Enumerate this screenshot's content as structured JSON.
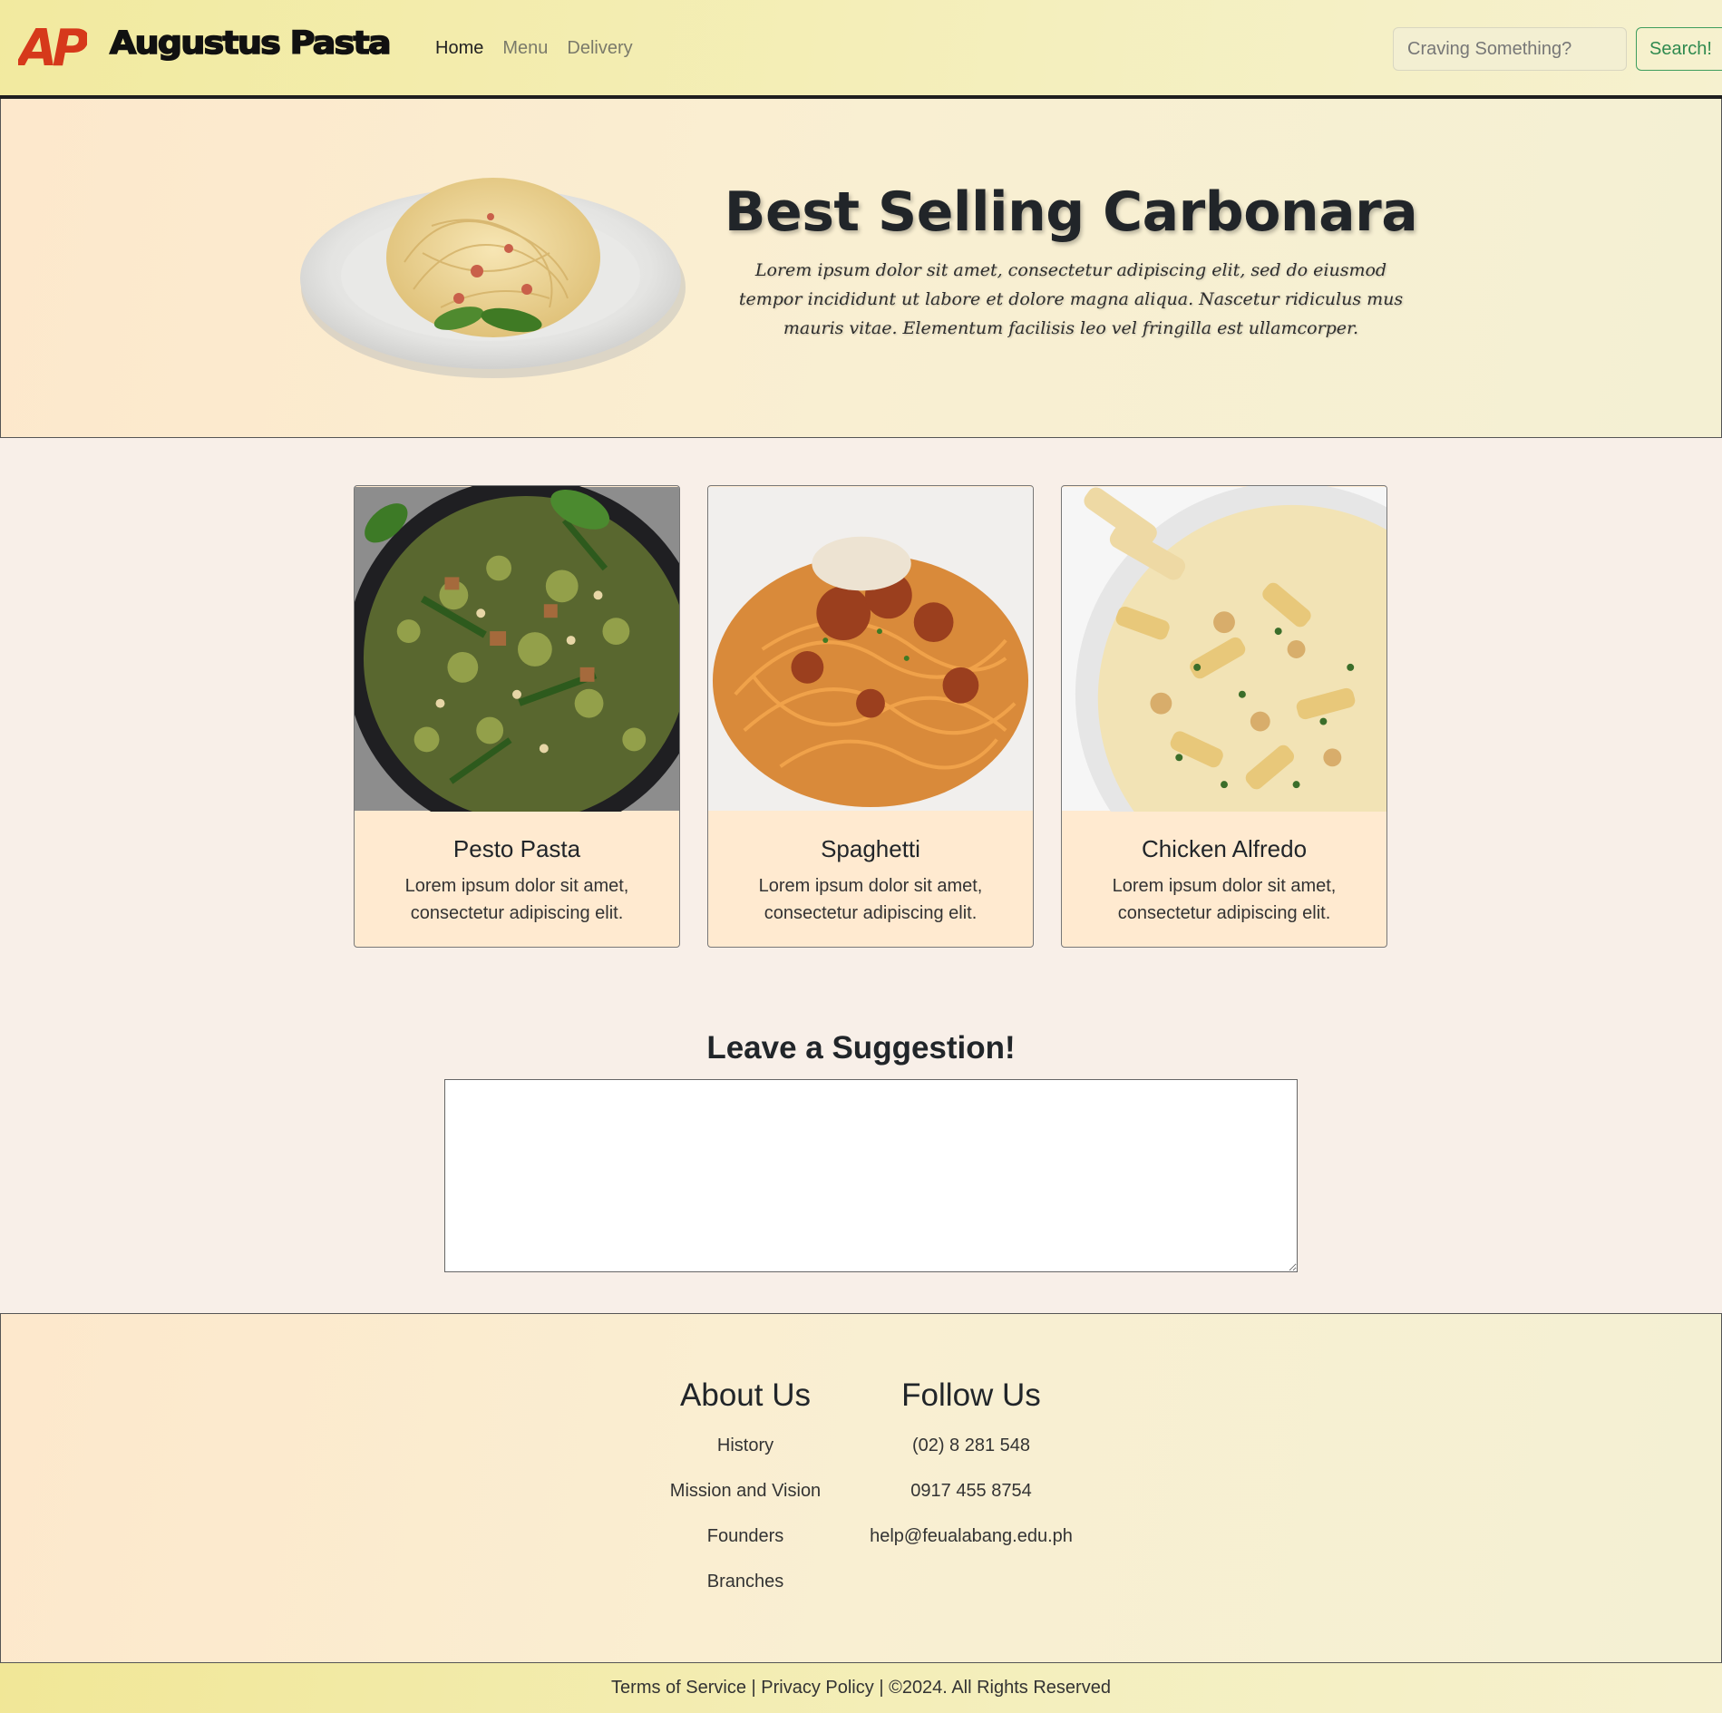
{
  "navbar": {
    "logo_text": "AP",
    "brand": "Augustus Pasta",
    "links": [
      {
        "label": "Home",
        "active": true
      },
      {
        "label": "Menu",
        "active": false
      },
      {
        "label": "Delivery",
        "active": false
      }
    ],
    "search_placeholder": "Craving Something?",
    "search_button": "Search!"
  },
  "hero": {
    "title": "Best Selling Carbonara",
    "text": "Lorem ipsum dolor sit amet, consectetur adipiscing elit, sed do eiusmod tempor incididunt ut labore et dolore magna aliqua. Nascetur ridiculus mus mauris vitae. Elementum facilisis leo vel fringilla est ullamcorper."
  },
  "cards": [
    {
      "title": "Pesto Pasta",
      "text": "Lorem ipsum dolor sit amet, consectetur adipiscing elit."
    },
    {
      "title": "Spaghetti",
      "text": "Lorem ipsum dolor sit amet, consectetur adipiscing elit."
    },
    {
      "title": "Chicken Alfredo",
      "text": "Lorem ipsum dolor sit amet, consectetur adipiscing elit."
    }
  ],
  "suggestion": {
    "title": "Leave a Suggestion!",
    "value": ""
  },
  "footer": {
    "about": {
      "title": "About Us",
      "items": [
        "History",
        "Mission and Vision",
        "Founders",
        "Branches"
      ]
    },
    "follow": {
      "title": "Follow Us",
      "items": [
        "(02) 8 281 548",
        "0917 455 8754",
        "help@feualabang.edu.ph"
      ]
    },
    "bottom": {
      "terms": "Terms of Service",
      "sep1": " | ",
      "privacy": "Privacy Policy",
      "sep2": " | ",
      "copyright": "©2024. All Rights Reserved"
    }
  },
  "colors": {
    "logo": "#d6391b",
    "search_accent": "#2f8a4f",
    "card_body": "#ffead0"
  }
}
